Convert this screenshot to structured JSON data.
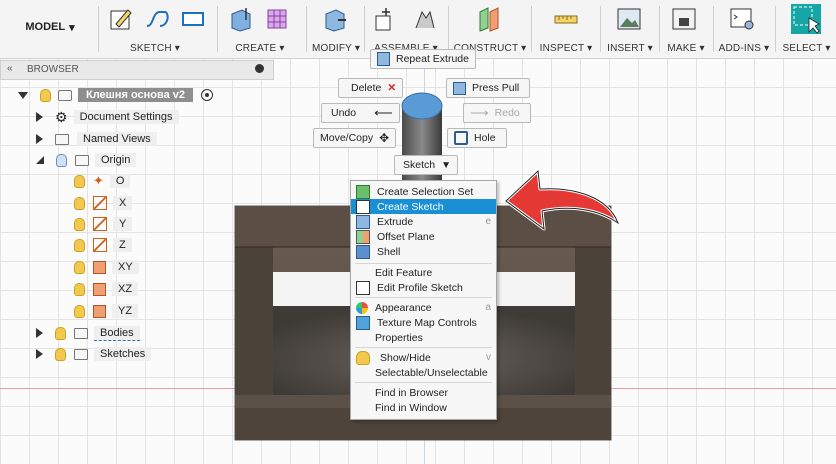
{
  "toolbar": {
    "model_label": "MODEL",
    "groups": [
      {
        "label": "SKETCH ▾"
      },
      {
        "label": "CREATE ▾"
      },
      {
        "label": "MODIFY ▾"
      },
      {
        "label": "ASSEMBLE ▾"
      },
      {
        "label": "CONSTRUCT ▾"
      },
      {
        "label": "INSPECT ▾"
      },
      {
        "label": "INSERT ▾"
      },
      {
        "label": "MAKE ▾"
      },
      {
        "label": "ADD-INS ▾"
      },
      {
        "label": "SELECT ▾"
      }
    ]
  },
  "browser": {
    "title": "BROWSER",
    "component": "Клешня основа v2",
    "items": [
      {
        "label": "Document Settings"
      },
      {
        "label": "Named Views"
      },
      {
        "label": "Origin"
      },
      {
        "label": "O"
      },
      {
        "label": "X"
      },
      {
        "label": "Y"
      },
      {
        "label": "Z"
      },
      {
        "label": "XY"
      },
      {
        "label": "XZ"
      },
      {
        "label": "YZ"
      },
      {
        "label": "Bodies"
      },
      {
        "label": "Sketches"
      }
    ]
  },
  "marking_menu": {
    "repeat": "Repeat Extrude",
    "delete": "Delete",
    "press_pull": "Press Pull",
    "undo": "Undo",
    "redo": "Redo",
    "move_copy": "Move/Copy",
    "hole": "Hole",
    "sketch": "Sketch"
  },
  "context_menu": {
    "items": [
      {
        "label": "Create Selection Set",
        "key": ""
      },
      {
        "label": "Create Sketch",
        "key": ""
      },
      {
        "label": "Extrude",
        "key": "e"
      },
      {
        "label": "Offset Plane",
        "key": ""
      },
      {
        "label": "Shell",
        "key": ""
      },
      {
        "label": "Edit Feature",
        "key": ""
      },
      {
        "label": "Edit Profile Sketch",
        "key": ""
      },
      {
        "label": "Appearance",
        "key": "a"
      },
      {
        "label": "Texture Map Controls",
        "key": ""
      },
      {
        "label": "Properties",
        "key": ""
      },
      {
        "label": "Show/Hide",
        "key": "v"
      },
      {
        "label": "Selectable/Unselectable",
        "key": ""
      },
      {
        "label": "Find in Browser",
        "key": ""
      },
      {
        "label": "Find in Window",
        "key": ""
      }
    ],
    "highlighted": "Create Sketch"
  },
  "colors": {
    "highlight": "#1a8fd6",
    "body": "#5a4e44",
    "annotation_arrow": "#e53935"
  }
}
